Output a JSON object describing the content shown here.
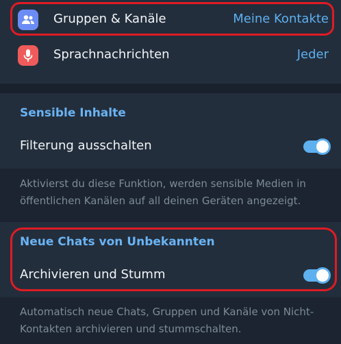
{
  "privacy_rows": {
    "groups": {
      "label": "Gruppen & Kanäle",
      "value": "Meine Kontakte",
      "icon": "people-icon",
      "icon_color": "#6c8cf5"
    },
    "voice": {
      "label": "Sprachnachrichten",
      "value": "Jeder",
      "icon": "microphone-icon",
      "icon_color": "#ef5b5b"
    }
  },
  "sensitive": {
    "title": "Sensible Inhalte",
    "toggle_label": "Filterung ausschalten",
    "toggle_on": true,
    "description": "Aktivierst du diese Funktion, werden sensible Medien in öffentlichen Kanälen auf all deinen Geräten angezeigt."
  },
  "unknown_chats": {
    "title": "Neue Chats von Unbekannten",
    "toggle_label": "Archivieren und Stumm",
    "toggle_on": true,
    "description": "Automatisch neue Chats, Gruppen und Kanäle von Nicht-Kontakten archivieren und stummschalten."
  },
  "colors": {
    "accent": "#5eb0ef",
    "highlight": "#e01b24",
    "background": "#1b2430",
    "card": "#232e3c"
  }
}
